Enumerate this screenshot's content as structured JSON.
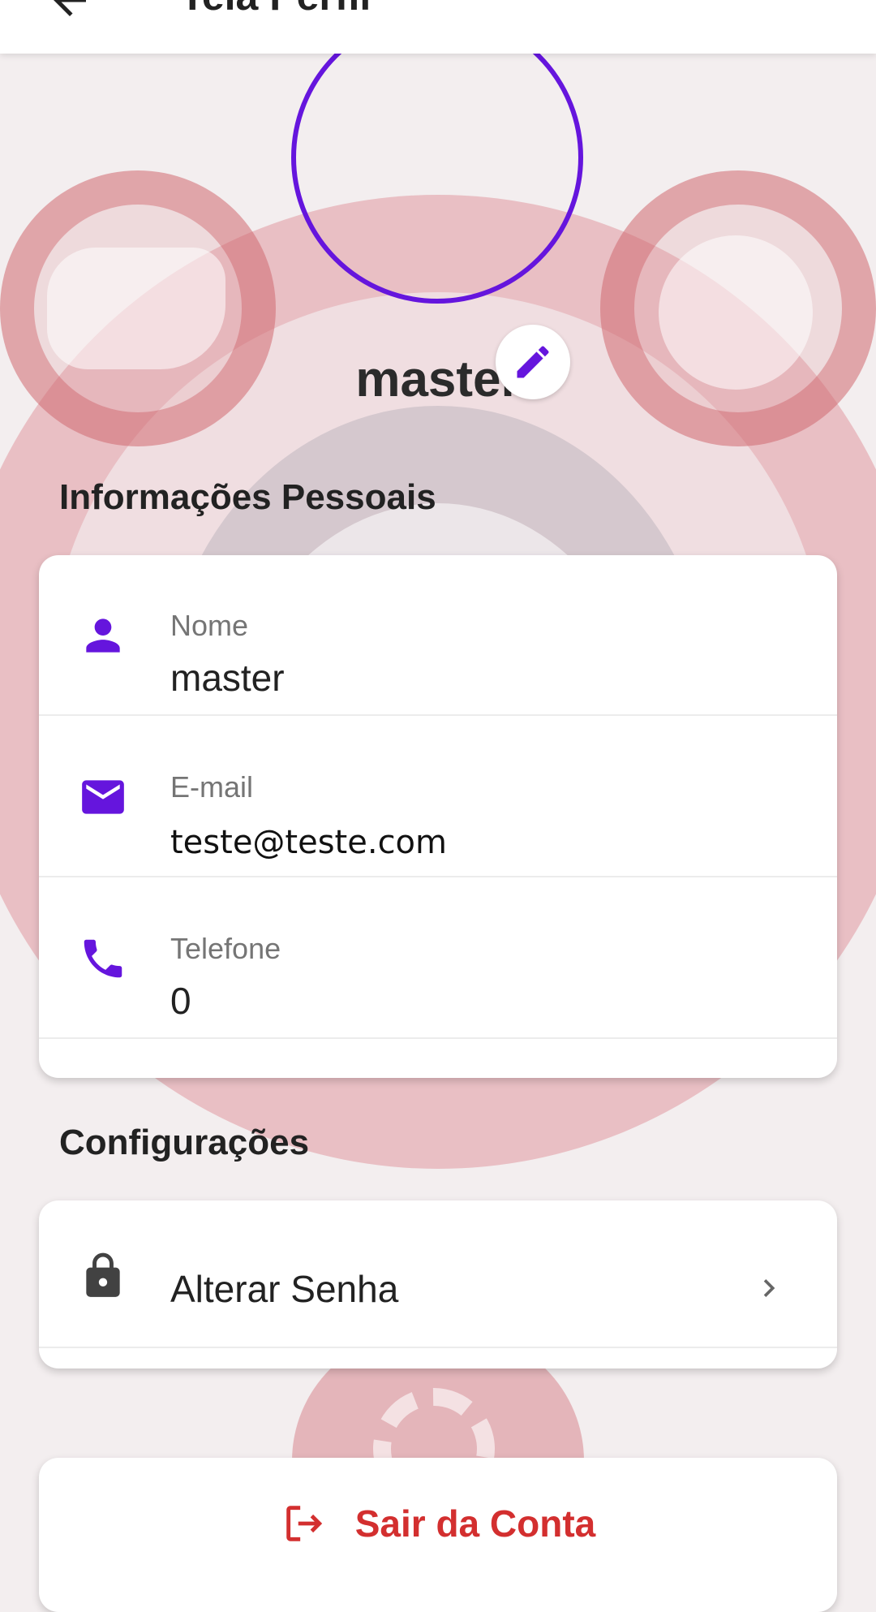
{
  "appbar": {
    "title": "Tela Perfil"
  },
  "profile": {
    "username": "master"
  },
  "personal_section": {
    "title": "Informações Pessoais",
    "fields": [
      {
        "label": "Nome",
        "value": "master",
        "icon": "person-icon"
      },
      {
        "label": "E-mail",
        "value": "teste@teste.com",
        "icon": "email-icon"
      },
      {
        "label": "Telefone",
        "value": "0",
        "icon": "phone-icon"
      }
    ]
  },
  "settings_section": {
    "title": "Configurações",
    "items": [
      {
        "label": "Alterar Senha",
        "icon": "lock-icon"
      }
    ]
  },
  "logout": {
    "label": "Sair da Conta",
    "icon": "logout-icon"
  },
  "colors": {
    "accent": "#6515dd",
    "danger": "#d32f2f",
    "icon_dark": "#424242"
  }
}
